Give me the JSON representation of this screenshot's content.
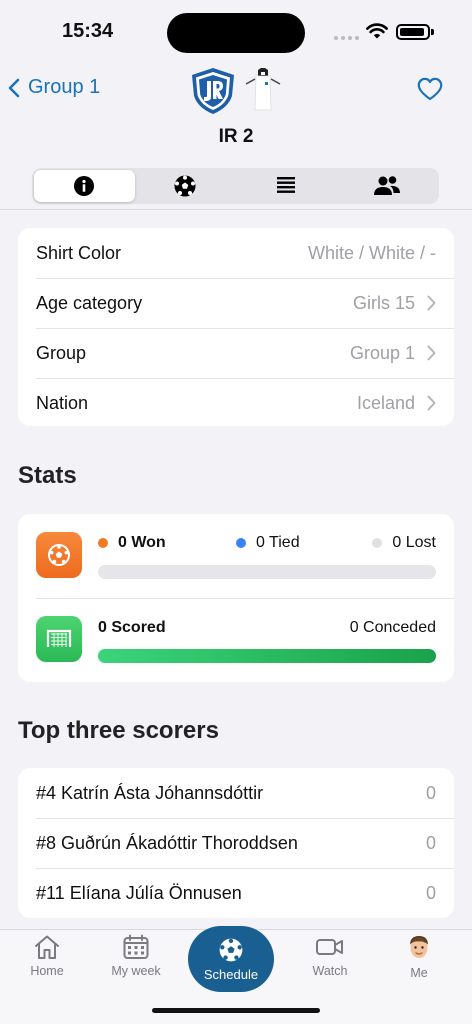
{
  "status": {
    "time": "15:34"
  },
  "header": {
    "back_label": "Group 1",
    "team_name": "IR 2",
    "tabs": [
      {
        "icon": "info-icon",
        "active": true
      },
      {
        "icon": "soccer-ball-icon",
        "active": false
      },
      {
        "icon": "list-icon",
        "active": false
      },
      {
        "icon": "people-icon",
        "active": false
      }
    ]
  },
  "info": {
    "rows": [
      {
        "label": "Shirt Color",
        "value": "White / White / -"
      },
      {
        "label": "Age category",
        "value": "Girls 15"
      },
      {
        "label": "Group",
        "value": "Group 1"
      },
      {
        "label": "Nation",
        "value": "Iceland"
      }
    ]
  },
  "stats": {
    "title": "Stats",
    "won": "0 Won",
    "tied": "0 Tied",
    "lost": "0 Lost",
    "scored": "0 Scored",
    "conceded": "0 Conceded",
    "colors": {
      "won": "#f07a22",
      "tied": "#3b82f6",
      "lost": "#e0e0e4"
    }
  },
  "scorers": {
    "title": "Top three scorers",
    "rows": [
      {
        "name": "#4 Katrín Ásta Jóhannsdóttir",
        "goals": "0"
      },
      {
        "name": "#8 Guðrún Ákadóttir Thoroddsen",
        "goals": "0"
      },
      {
        "name": "#11 Elíana Júlía Önnusen",
        "goals": "0"
      }
    ]
  },
  "tabbar": {
    "home": "Home",
    "my_week": "My week",
    "schedule": "Schedule",
    "watch": "Watch",
    "me": "Me"
  }
}
